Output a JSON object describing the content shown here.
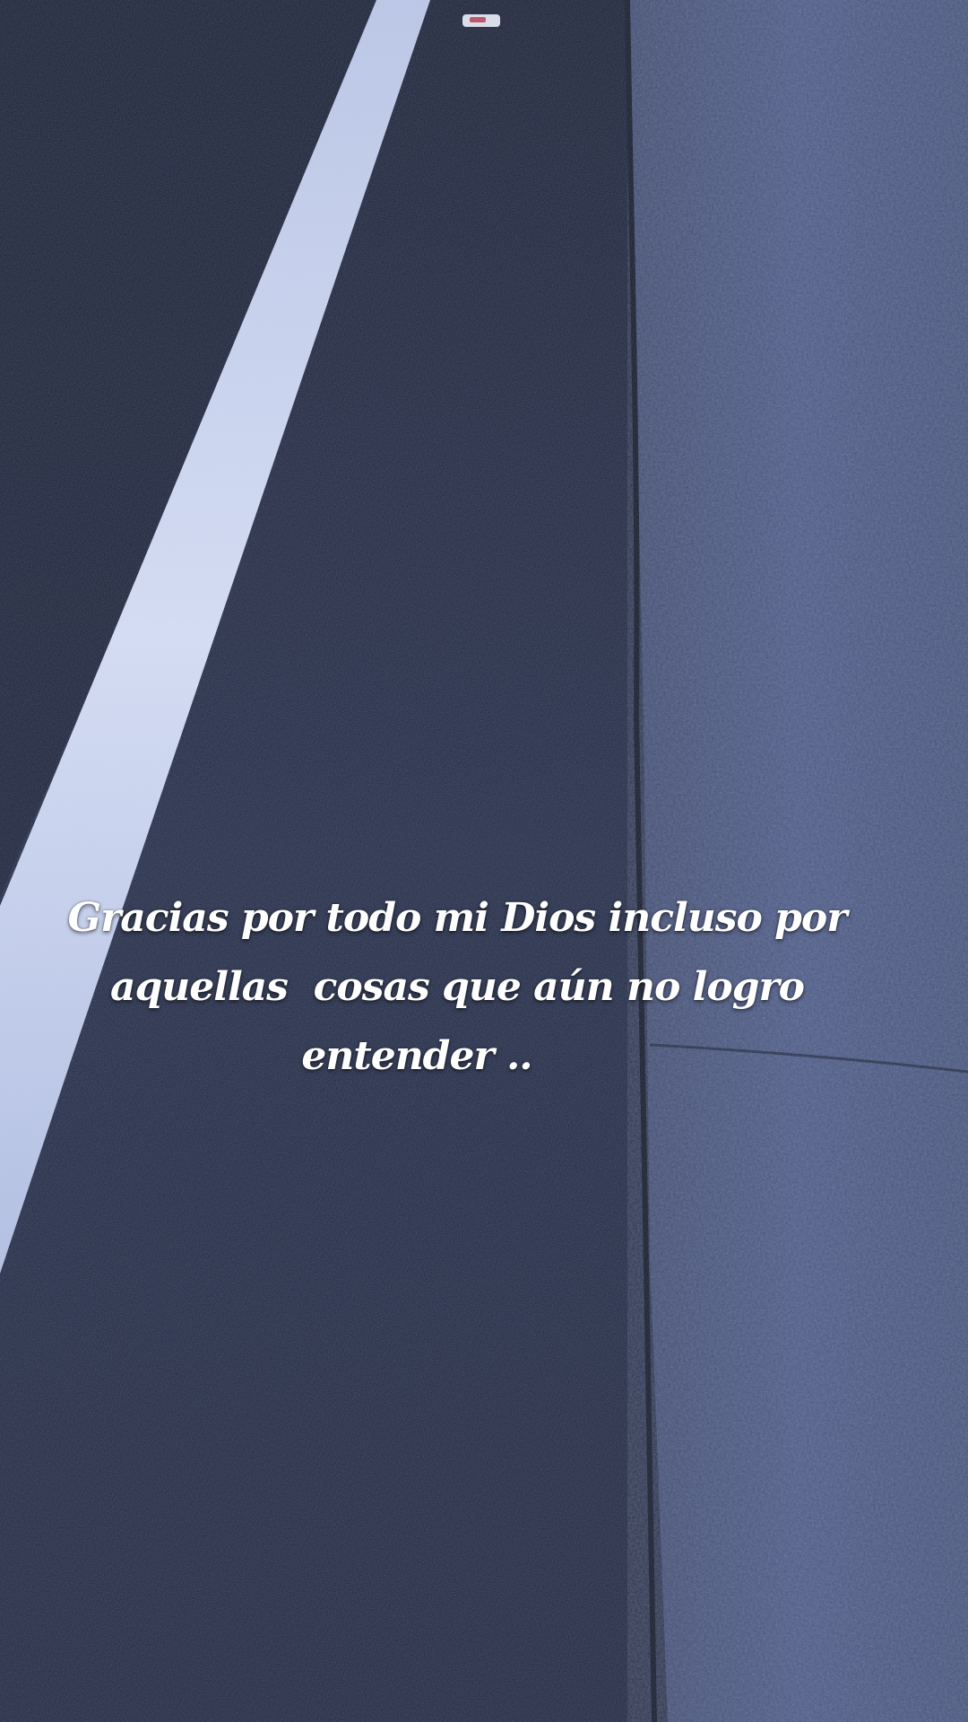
{
  "scene": {
    "subject": "road-edge-photo",
    "colors": {
      "asphalt": "#1f2742",
      "asphalt_dark": "#161c30",
      "shoulder": "#3a4770",
      "lane_line": "#c7d2ee",
      "reflector": "#e8e8ee",
      "caption": "#ffffff"
    }
  },
  "caption": {
    "line1": "Gracias por todo mi Dios incluso por",
    "line2": "aquellas  cosas que aún no logro",
    "line3": "entender .."
  }
}
